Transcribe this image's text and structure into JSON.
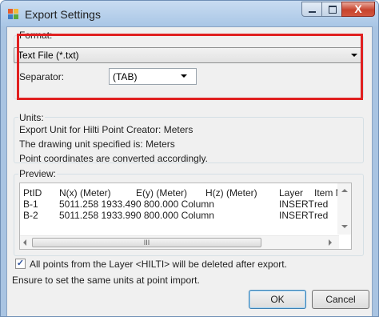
{
  "window": {
    "title": "Export Settings",
    "close_glyph": "X"
  },
  "format": {
    "label": "Format:",
    "value": "Text File (*.txt)",
    "separator_label": "Separator:",
    "separator_value": "(TAB)"
  },
  "units": {
    "label": "Units:",
    "lines": [
      "Export Unit for Hilti Point Creator: Meters",
      "The drawing unit specified is: Meters",
      "Point coordinates are converted accordingly."
    ]
  },
  "preview": {
    "label": "Preview:",
    "headers": [
      "PtID",
      "N(x) (Meter)",
      "E(y) (Meter)",
      "H(z) (Meter)",
      "Layer",
      "Item Nc"
    ],
    "rows": [
      [
        "B-1",
        "5011.258 1933.490 800.000  Column",
        "INSERT",
        "red"
      ],
      [
        "B-2",
        "5011.258 1933.990 800.000  Column",
        "INSERT",
        "red"
      ]
    ],
    "scroll_thumb_grip": "III"
  },
  "delete_checkbox": {
    "checked": true,
    "label": "All points from the Layer <HILTI> will be deleted after export."
  },
  "note": "Ensure to set the same units at point import.",
  "buttons": {
    "ok": "OK",
    "cancel": "Cancel"
  },
  "colors": {
    "highlight": "#e02020",
    "titlebar": "#b9d1ea",
    "close_button": "#c7432d"
  }
}
